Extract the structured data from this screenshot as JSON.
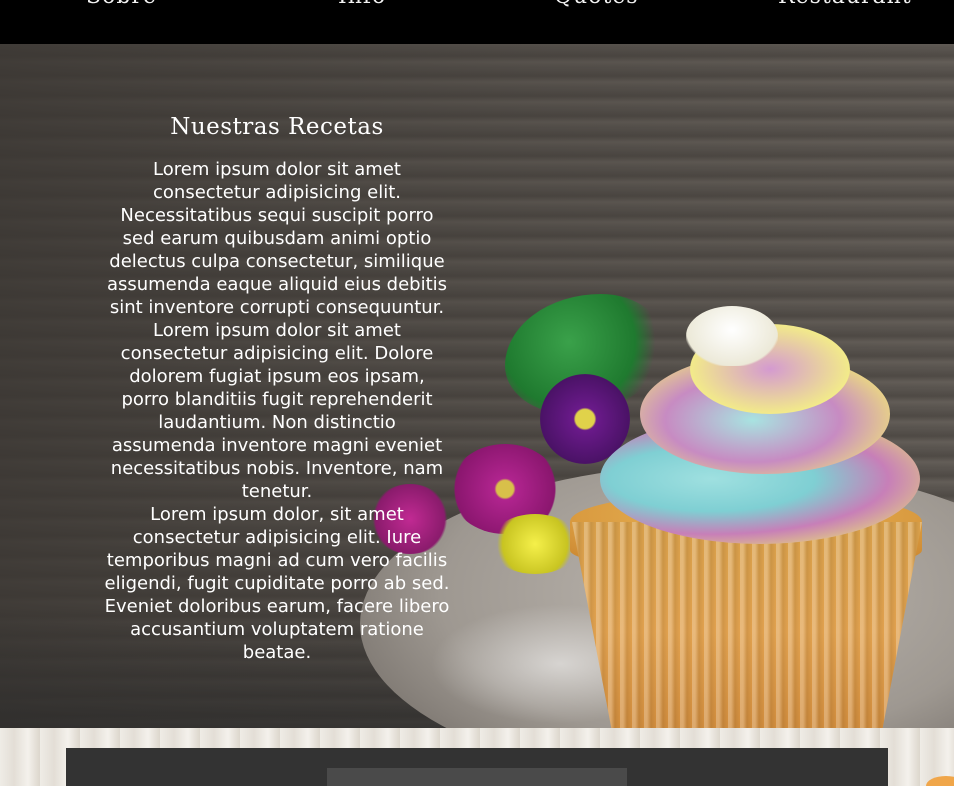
{
  "nav": {
    "items": [
      {
        "label": "Sobre"
      },
      {
        "label": "Info"
      },
      {
        "label": "Quotes"
      },
      {
        "label": "Restaurant"
      }
    ]
  },
  "hero": {
    "title": "Nuestras Recetas",
    "paragraphs": [
      "Lorem ipsum dolor sit amet consectetur adipisicing elit. Necessitatibus sequi suscipit porro sed earum quibusdam animi optio delectus culpa consectetur, similique assumenda eaque aliquid eius debitis sint inventore corrupti consequuntur.",
      "Lorem ipsum dolor sit amet consectetur adipisicing elit. Dolore dolorem fugiat ipsum eos ipsam, porro blanditiis fugit reprehenderit laudantium. Non distinctio assumenda inventore magni eveniet necessitatibus nobis. Inventore, nam tenetur.",
      "Lorem ipsum dolor, sit amet consectetur adipisicing elit. Iure temporibus magni ad cum vero facilis eligendi, fugit cupiditate porro ab sed. Eveniet doloribus earum, facere libero accusantium voluptatem ratione beatae."
    ]
  },
  "colors": {
    "nav_background": "#000000",
    "text": "#ffffff",
    "panel": "#333333"
  }
}
